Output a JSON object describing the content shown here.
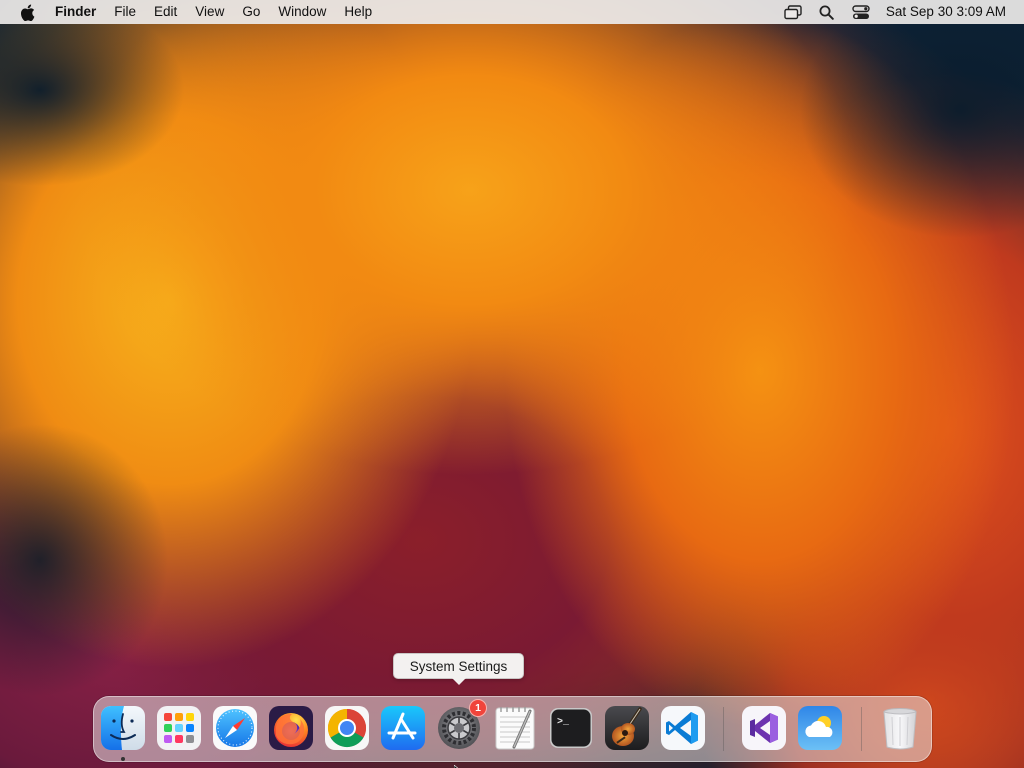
{
  "menubar": {
    "apple_icon": "apple-logo-icon",
    "app_name": "Finder",
    "items": [
      "File",
      "Edit",
      "View",
      "Go",
      "Window",
      "Help"
    ],
    "status_icons": [
      "screen-mirroring-icon",
      "spotlight-search-icon",
      "control-center-icon"
    ],
    "clock": "Sat Sep 30  3:09 AM"
  },
  "tooltip": {
    "text": "System Settings"
  },
  "dock": {
    "apps": [
      {
        "name": "Finder",
        "icon": "finder-icon",
        "running": true
      },
      {
        "name": "Launchpad",
        "icon": "launchpad-icon"
      },
      {
        "name": "Safari",
        "icon": "safari-icon"
      },
      {
        "name": "Firefox",
        "icon": "firefox-icon"
      },
      {
        "name": "Google Chrome",
        "icon": "chrome-icon"
      },
      {
        "name": "App Store",
        "icon": "app-store-icon"
      },
      {
        "name": "System Settings",
        "icon": "system-settings-icon",
        "badge": "1"
      },
      {
        "name": "TextEdit",
        "icon": "textedit-icon"
      },
      {
        "name": "Terminal",
        "icon": "terminal-icon"
      },
      {
        "name": "GarageBand",
        "icon": "garageband-icon"
      },
      {
        "name": "Visual Studio Code",
        "icon": "vscode-icon"
      },
      {
        "name": "Visual Studio",
        "icon": "visual-studio-icon"
      },
      {
        "name": "Weather",
        "icon": "weather-icon"
      },
      {
        "name": "Trash",
        "icon": "trash-icon"
      }
    ]
  },
  "colors": {
    "menubar_bg": "#ECE9E8",
    "badge_red": "#F0443B",
    "wallpaper_orange": "#F28A12",
    "wallpaper_navy": "#0C2236"
  }
}
